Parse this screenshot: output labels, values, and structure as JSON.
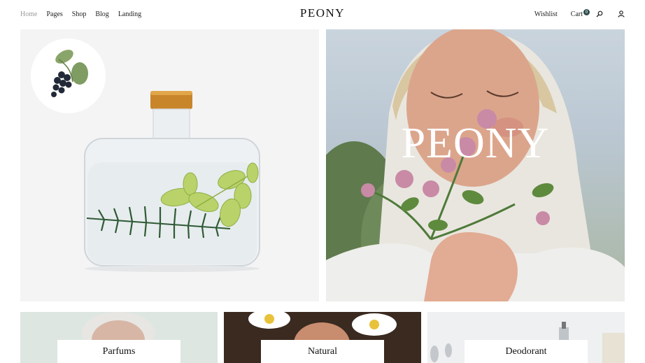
{
  "nav": {
    "items": [
      {
        "label": "Home"
      },
      {
        "label": "Pages"
      },
      {
        "label": "Shop"
      },
      {
        "label": "Blog"
      },
      {
        "label": "Landing"
      }
    ]
  },
  "brand": {
    "logo": "PEONY"
  },
  "util": {
    "wishlist": "Wishlist",
    "cart": "Cart",
    "cart_count": "0"
  },
  "hero": {
    "title": "PEONY"
  },
  "categories": [
    {
      "label": "Parfums"
    },
    {
      "label": "Natural"
    },
    {
      "label": "Deodorant"
    }
  ],
  "colors": {
    "accent": "#2b4a49",
    "active_nav": "#9a9a9a"
  }
}
